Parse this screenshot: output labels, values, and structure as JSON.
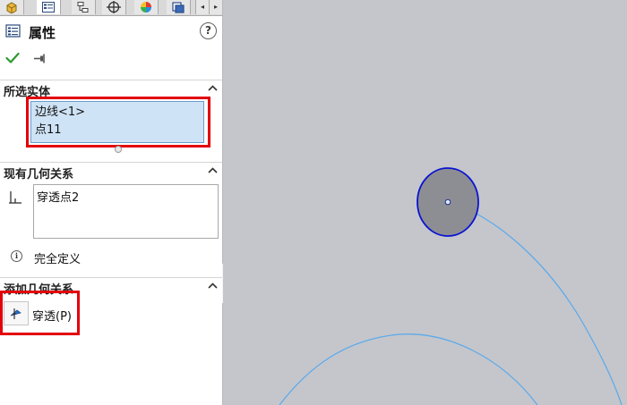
{
  "panel": {
    "title": "属性",
    "help": "?",
    "tabs": [
      {
        "name": "feature-manager-icon"
      },
      {
        "name": "property-manager-icon",
        "active": true
      },
      {
        "name": "configuration-manager-icon"
      },
      {
        "name": "dimxpert-manager-icon"
      },
      {
        "name": "display-manager-icon"
      },
      {
        "name": "view-cube-icon"
      }
    ],
    "scroll_left": "◂",
    "scroll_right": "▸"
  },
  "selected_entities": {
    "heading": "所选实体",
    "items": [
      "边线<1>",
      "点11"
    ]
  },
  "existing_relations": {
    "heading": "现有几何关系",
    "items": [
      "穿透点2"
    ],
    "status": "完全定义"
  },
  "add_relations": {
    "heading": "添加几何关系",
    "pierce_label": "穿透(P)"
  },
  "colors": {
    "highlight_red": "#e3000b",
    "selection_bg": "#cfe3f6",
    "viewport_bg": "#c4c6cc",
    "circle_stroke": "#0a14d2",
    "curve_stroke": "#5aa9ea",
    "ok_green": "#2f9a2f"
  }
}
